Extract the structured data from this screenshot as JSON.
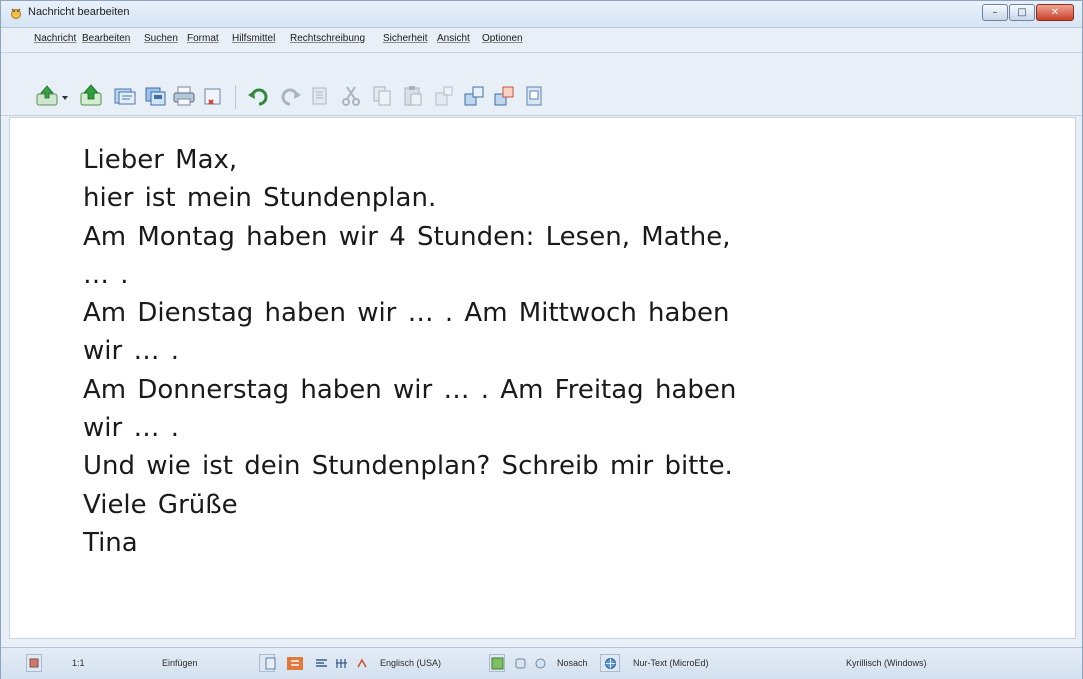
{
  "window": {
    "title": "Nachricht bearbeiten",
    "controls": {
      "minimize": "–",
      "maximize": "□",
      "close": "✕"
    }
  },
  "menu": [
    "Nachricht",
    "Bearbeiten",
    "Suchen",
    "Format",
    "Hilfsmittel",
    "Rechtschreibung",
    "Sicherheit",
    "Ansicht",
    "Optionen"
  ],
  "toolbar": {
    "buttons": [
      "send-icon",
      "dropdown-arrow-icon",
      "attach-icon",
      "address-book-icon",
      "save-icon",
      "print-icon",
      "delete-icon",
      "undo-icon",
      "redo-icon",
      "select-all-icon",
      "cut-icon",
      "copy-icon",
      "paste-icon",
      "format-icon",
      "insert-icon",
      "image-icon",
      "spell-check-icon"
    ]
  },
  "message": {
    "lines": [
      "Lieber Max,",
      "hier ist mein Stundenplan.",
      "Am Montag haben wir 4 Stunden: Lesen, Mathe,",
      "… .",
      "Am Dienstag haben wir … . Am Mittwoch haben",
      "wir … .",
      "Am Donnerstag haben wir … . Am Freitag haben",
      "wir … .",
      "Und wie ist dein Stundenplan? Schreib mir bitte.",
      "Viele Grüße",
      "Tina"
    ]
  },
  "status": {
    "position": "1:1",
    "mode": "Einfügen",
    "language": "Englisch (USA)",
    "spell": "Nosach",
    "format": "Nur-Text (MicroEd)",
    "encoding": "Kyrillisch (Windows)"
  },
  "colors": {
    "accent": "#2f7d32",
    "titlebar": "#d6e4f3",
    "close": "#c8412b"
  }
}
